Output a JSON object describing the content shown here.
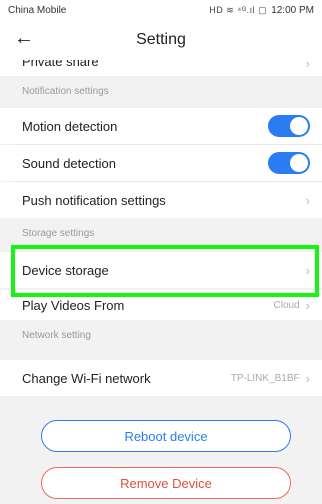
{
  "status_bar": {
    "carrier": "China Mobile",
    "icons": "HD ≋ ⁴ᴳ.ıl ▢",
    "time": "12:00 PM"
  },
  "header": {
    "back_icon": "arrow-left-icon",
    "title": "Setting"
  },
  "partial": {
    "label": "Private share"
  },
  "sections": {
    "notifications": "Notification settings",
    "storage": "Storage settings",
    "network": "Network setting"
  },
  "rows": {
    "motion": {
      "label": "Motion detection",
      "enabled": true
    },
    "sound": {
      "label": "Sound detection",
      "enabled": true
    },
    "push": {
      "label": "Push notification settings"
    },
    "device_storage": {
      "label": "Device storage"
    },
    "play_videos": {
      "label": "Play Videos From",
      "value": "Cloud"
    },
    "wifi": {
      "label": "Change Wi-Fi network",
      "value": "TP-LINK_B1BF"
    }
  },
  "buttons": {
    "reboot": "Reboot device",
    "remove": "Remove Device"
  },
  "colors": {
    "accent": "#2b7cf2",
    "danger": "#e0503f",
    "highlight": "#14f514"
  }
}
